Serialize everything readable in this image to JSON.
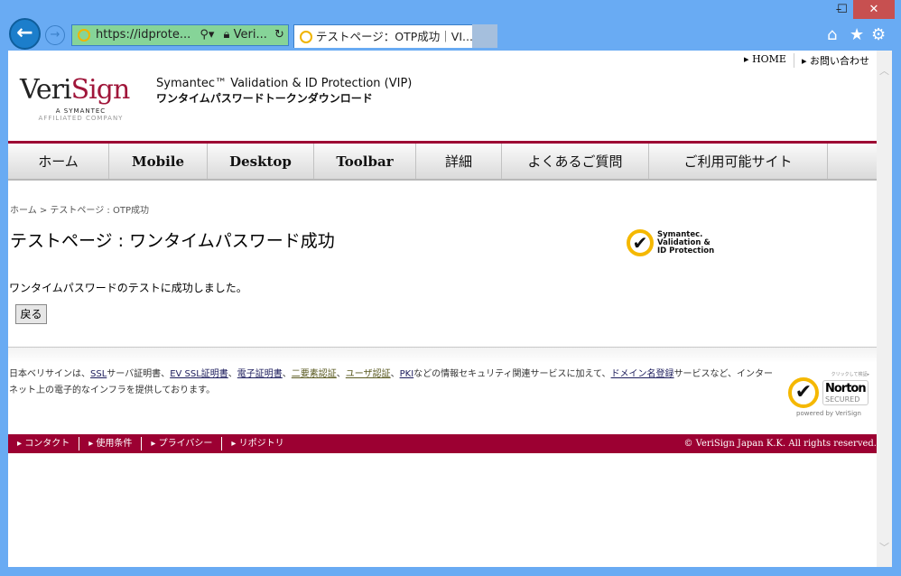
{
  "browser": {
    "url": "https://idprote...",
    "cert_label": "Veri...",
    "tab_title": "テストページ：OTP成功｜VI...",
    "controls": {
      "minimize": "–",
      "maximize": "☐",
      "close": "✕"
    }
  },
  "header": {
    "top_links": [
      "HOME",
      "お問い合わせ"
    ],
    "logo_text": "VeriSign",
    "logo_sub1": "A SYMANTEC",
    "logo_sub2": "AFFILIATED COMPANY",
    "title_en": "Symantec™ Validation & ID Protection (VIP)",
    "title_jp": "ワンタイムパスワードトークンダウンロード"
  },
  "menu": [
    {
      "label": "ホーム"
    },
    {
      "label": "Mobile"
    },
    {
      "label": "Desktop"
    },
    {
      "label": "Toolbar"
    },
    {
      "label": "詳細"
    },
    {
      "label": "よくあるご質問"
    },
    {
      "label": "ご利用可能サイト"
    }
  ],
  "main": {
    "breadcrumb": "ホーム > テストページ : OTP成功",
    "heading": "テストページ : ワンタイムパスワード成功",
    "message": "ワンタイムパスワードのテストに成功しました。",
    "back_button": "戻る",
    "vip_logo": [
      "Symantec.",
      "Validation &",
      "ID Protection"
    ]
  },
  "footer": {
    "t1": "日本ベリサインは、",
    "links": [
      "SSL",
      "EV SSL証明書",
      "電子証明書",
      "二要素認証",
      "ユーザ認証",
      "PKI",
      "ドメイン名登録"
    ],
    "t2": "サーバ証明書、",
    "t3": "、",
    "t4": "などの情報セキュリティ関連サービスに加えて、",
    "t5": "サービスなど、インターネット上の電子的なインフラを提供しております。",
    "norton": {
      "top": "クリックして検証▸",
      "name": "Norton",
      "secured": "SECURED",
      "powered": "powered by VeriSign"
    },
    "bottom_links": [
      "コンタクト",
      "使用条件",
      "プライバシー",
      "リポジトリ"
    ],
    "copyright": "© VeriSign Japan K.K. All rights reserved."
  },
  "colors": {
    "brand": "#9c0032",
    "frame": "#69abf3",
    "secure_address": "#86d498"
  }
}
